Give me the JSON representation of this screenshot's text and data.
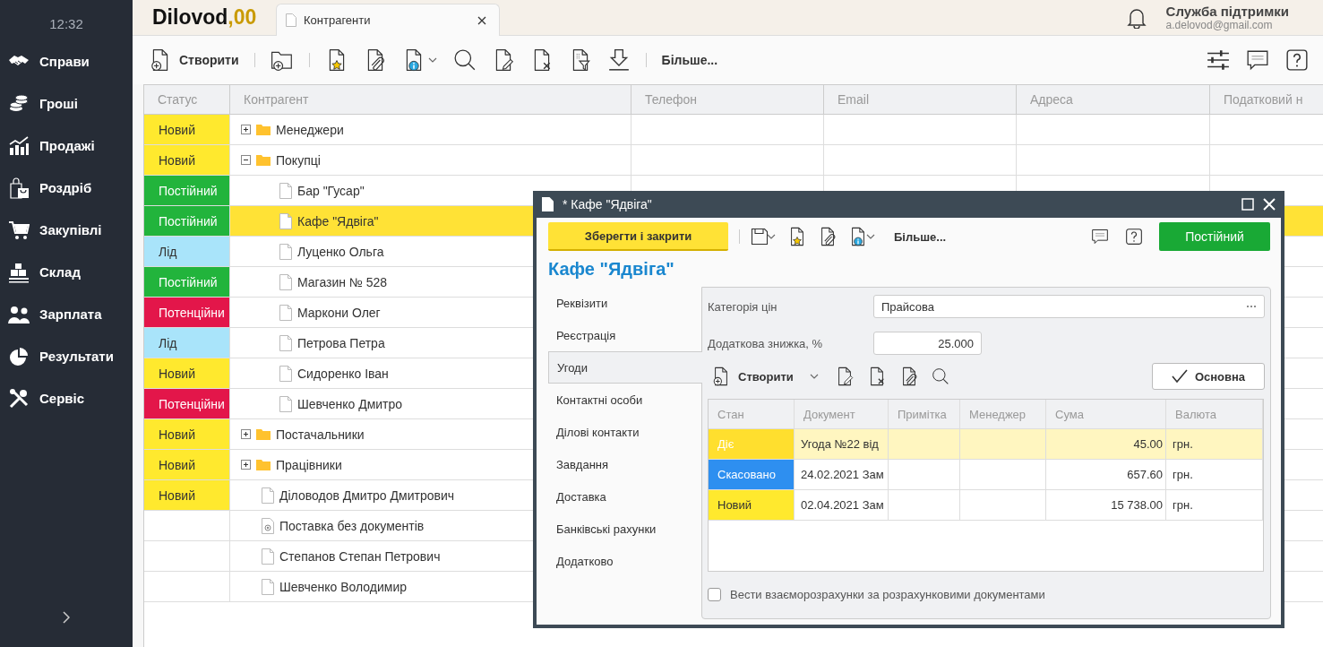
{
  "sidebar": {
    "time": "12:32",
    "items": [
      {
        "label": "Справи"
      },
      {
        "label": "Гроші"
      },
      {
        "label": "Продажі"
      },
      {
        "label": "Роздріб"
      },
      {
        "label": "Закупівлі"
      },
      {
        "label": "Склад"
      },
      {
        "label": "Зарплата"
      },
      {
        "label": "Результати"
      },
      {
        "label": "Сервіс"
      }
    ]
  },
  "header": {
    "logo": "Dilovod",
    "logo_suffix": ",00",
    "tab": {
      "label": "Контрагенти"
    },
    "support": {
      "title": "Служба підтримки",
      "email": "a.delovod@gmail.com"
    }
  },
  "toolbar": {
    "create": "Створити",
    "more": "Більше..."
  },
  "table": {
    "columns": [
      "Статус",
      "Контрагент",
      "Телефон",
      "Email",
      "Адреса",
      "Податковий н"
    ],
    "rows": [
      {
        "status": "Новий",
        "color": "#ffe92e",
        "name": "Менеджери",
        "kind": "folder",
        "expanded": false,
        "selected": false
      },
      {
        "status": "Новий",
        "color": "#ffe92e",
        "name": "Покупці",
        "kind": "folder",
        "expanded": true,
        "selected": false,
        "children": [
          {
            "status": "Постійний",
            "color": "#22b43c",
            "name": "Бар \"Гусар\"",
            "kind": "document",
            "selected": false
          },
          {
            "status": "Постійний",
            "color": "#22b43c",
            "name": "Кафе \"Ядвіга\"",
            "kind": "document",
            "selected": true
          },
          {
            "status": "Лід",
            "color": "#a9e4fa",
            "name": "Луценко Ольга",
            "kind": "document",
            "selected": false
          },
          {
            "status": "Постійний",
            "color": "#22b43c",
            "name": "Магазин № 528",
            "kind": "document",
            "selected": false
          },
          {
            "status": "Потенційни",
            "color": "#e3164a",
            "name": "Маркони Олег",
            "kind": "document",
            "selected": false
          },
          {
            "status": "Лід",
            "color": "#a9e4fa",
            "name": "Петрова Петра",
            "kind": "document",
            "selected": false
          },
          {
            "status": "Новий",
            "color": "#ffe92e",
            "name": "Сидоренко Іван",
            "kind": "document",
            "selected": false
          },
          {
            "status": "Потенційни",
            "color": "#e3164a",
            "name": "Шевченко Дмитро",
            "kind": "document",
            "selected": false
          }
        ]
      },
      {
        "status": "Новий",
        "color": "#ffe92e",
        "name": "Постачальники",
        "kind": "folder",
        "expanded": false,
        "selected": false
      },
      {
        "status": "Новий",
        "color": "#ffe92e",
        "name": "Працівники",
        "kind": "folder",
        "expanded": false,
        "selected": false
      },
      {
        "status": "Новий",
        "color": "#ffe92e",
        "name": "Діловодов Дмитро Дмитрович",
        "kind": "document",
        "selected": false
      },
      {
        "name": "Поставка без документів",
        "kind": "service",
        "selected": false
      },
      {
        "name": "Степанов Степан Петрович",
        "kind": "document",
        "selected": false
      },
      {
        "name": "Шевченко Володимир",
        "kind": "document",
        "selected": false
      }
    ]
  },
  "dialog": {
    "title": "* Кафе \"Ядвіга\"",
    "save_close": "Зберегти і закрити",
    "more": "Більше...",
    "status_button": {
      "label": "Постійний",
      "color": "#19a935"
    },
    "heading": "Кафе \"Ядвіга\"",
    "tabs": [
      {
        "label": "Реквізити",
        "selected": false
      },
      {
        "label": "Реєстрація",
        "selected": false
      },
      {
        "label": "Угоди",
        "selected": true
      },
      {
        "label": "Контактні особи",
        "selected": false
      },
      {
        "label": "Ділові контакти",
        "selected": false
      },
      {
        "label": "Завдання",
        "selected": false
      },
      {
        "label": "Доставка",
        "selected": false
      },
      {
        "label": "Банківські рахунки",
        "selected": false
      },
      {
        "label": "Додатково",
        "selected": false
      }
    ],
    "fields": [
      {
        "label": "Категорія цін",
        "value": "Прайсова",
        "kind": "select"
      },
      {
        "label": "Додаткова знижка, %",
        "value": "25.000",
        "kind": "number"
      }
    ],
    "subtoolbar": {
      "create": "Створити",
      "main": "Основна"
    },
    "grid": {
      "columns": [
        "Стан",
        "Документ",
        "Примітка",
        "Менеджер",
        "Сума",
        "Валюта"
      ],
      "rows": [
        {
          "status": "Діє",
          "color": "#ffdf2e",
          "document": "Угода №22 від",
          "sum": "45.00",
          "currency": "грн.",
          "selected": true
        },
        {
          "status": "Скасовано",
          "color": "#2e8ff0",
          "document": "24.02.2021 Зам",
          "sum": "657.60",
          "currency": "грн.",
          "selected": false
        },
        {
          "status": "Новий",
          "color": "#ffe92e",
          "document": "02.04.2021 Зам",
          "sum": "15 738.00",
          "currency": "грн.",
          "selected": false
        }
      ]
    },
    "checkbox": {
      "label": "Вести взаєморозрахунки за розрахунковими документами",
      "checked": false
    }
  }
}
